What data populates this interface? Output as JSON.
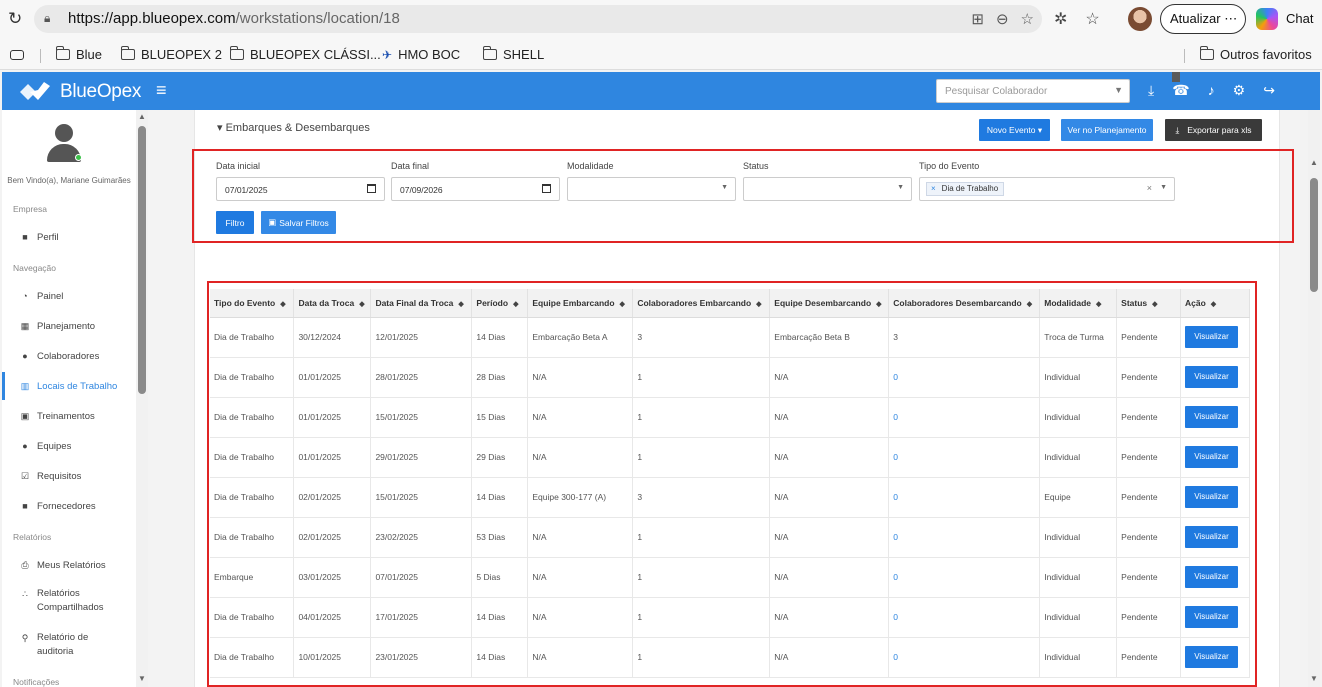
{
  "browser": {
    "url_host": "https://app.blueopex.com",
    "url_path": "/workstations/location/18",
    "update_label": "Atualizar",
    "update_more": "⋯",
    "chat_label": "Chat",
    "bookmarks": [
      "Blue",
      "BLUEOPEX 2",
      "BLUEOPEX CLÁSSI...",
      "HMO BOC",
      "SHELL"
    ],
    "other_favorites": "Outros favoritos"
  },
  "app": {
    "logo_text": "BlueOpex",
    "search_placeholder": "Pesquisar Colaborador",
    "colors": {
      "navbar": "#2f86e0",
      "primary_button": "#1f7ae0",
      "dark_button": "#3a3a3a",
      "highlight": "#e02424"
    }
  },
  "sidebar": {
    "welcome": "Bem Vindo(a), Mariane Guimarães",
    "sections": {
      "empresa": "Empresa",
      "navegacao": "Navegação",
      "relatorios": "Relatórios",
      "notificacoes": "Notificações"
    },
    "items": {
      "perfil": "Perfil",
      "painel": "Painel",
      "planejamento": "Planejamento",
      "colaboradores": "Colaboradores",
      "locais": "Locais de Trabalho",
      "treinamentos": "Treinamentos",
      "equipes": "Equipes",
      "requisitos": "Requisitos",
      "fornecedores": "Fornecedores",
      "meus_relatorios": "Meus Relatórios",
      "relatorios_compartilhados_1": "Relatórios",
      "relatorios_compartilhados_2": "Compartilhados",
      "relatorio_auditoria_1": "Relatório de",
      "relatorio_auditoria_2": "auditoria"
    }
  },
  "panel": {
    "title": "▾ Embarques & Desembarques",
    "novo_evento": "Novo Evento ▾",
    "ver_planejamento": "Ver no Planejamento",
    "exportar": "Exportar para xls"
  },
  "filters": {
    "data_inicial_label": "Data inicial",
    "data_inicial_value": "07/01/2025",
    "data_final_label": "Data final",
    "data_final_value": "07/09/2026",
    "modalidade_label": "Modalidade",
    "status_label": "Status",
    "tipo_evento_label": "Tipo do Evento",
    "tipo_evento_chip": "Dia de Trabalho",
    "filtro_button": "Filtro",
    "salvar_button": "Salvar Filtros"
  },
  "table": {
    "headers": [
      "Tipo do Evento",
      "Data da Troca",
      "Data Final da Troca",
      "Período",
      "Equipe Embarcando",
      "Colaboradores Embarcando",
      "Equipe Desembarcando",
      "Colaboradores Desembarcando",
      "Modalidade",
      "Status",
      "Ação"
    ],
    "action_label": "Visualizar",
    "rows": [
      [
        "Dia de Trabalho",
        "30/12/2024",
        "12/01/2025",
        "14 Dias",
        "Embarcação Beta A",
        "3",
        "Embarcação Beta B",
        "3",
        "Troca de Turma",
        "Pendente"
      ],
      [
        "Dia de Trabalho",
        "01/01/2025",
        "28/01/2025",
        "28 Dias",
        "N/A",
        "1",
        "N/A",
        "0",
        "Individual",
        "Pendente"
      ],
      [
        "Dia de Trabalho",
        "01/01/2025",
        "15/01/2025",
        "15 Dias",
        "N/A",
        "1",
        "N/A",
        "0",
        "Individual",
        "Pendente"
      ],
      [
        "Dia de Trabalho",
        "01/01/2025",
        "29/01/2025",
        "29 Dias",
        "N/A",
        "1",
        "N/A",
        "0",
        "Individual",
        "Pendente"
      ],
      [
        "Dia de Trabalho",
        "02/01/2025",
        "15/01/2025",
        "14 Dias",
        "Equipe 300-177 (A)",
        "3",
        "N/A",
        "0",
        "Equipe",
        "Pendente"
      ],
      [
        "Dia de Trabalho",
        "02/01/2025",
        "23/02/2025",
        "53 Dias",
        "N/A",
        "1",
        "N/A",
        "0",
        "Individual",
        "Pendente"
      ],
      [
        "Embarque",
        "03/01/2025",
        "07/01/2025",
        "5 Dias",
        "N/A",
        "1",
        "N/A",
        "0",
        "Individual",
        "Pendente"
      ],
      [
        "Dia de Trabalho",
        "04/01/2025",
        "17/01/2025",
        "14 Dias",
        "N/A",
        "1",
        "N/A",
        "0",
        "Individual",
        "Pendente"
      ],
      [
        "Dia de Trabalho",
        "10/01/2025",
        "23/01/2025",
        "14 Dias",
        "N/A",
        "1",
        "N/A",
        "0",
        "Individual",
        "Pendente"
      ]
    ]
  }
}
